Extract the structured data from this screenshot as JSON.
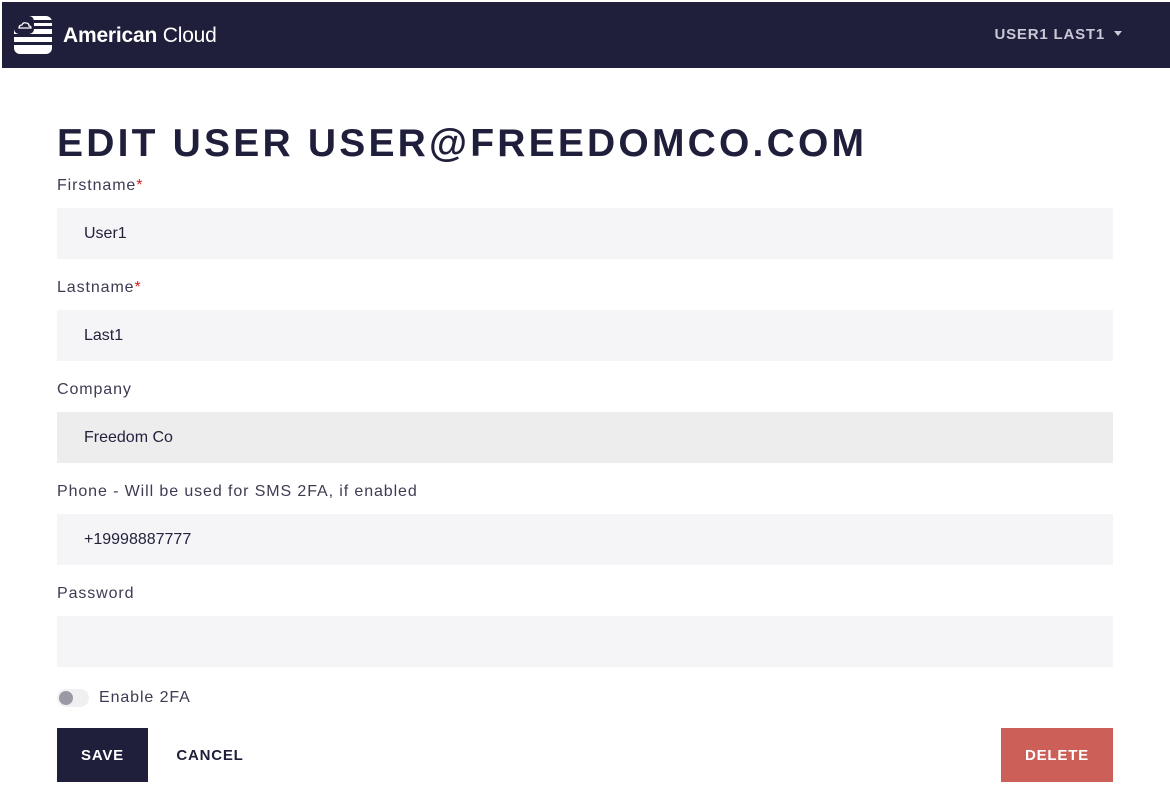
{
  "header": {
    "brand_bold": "American",
    "brand_regular": " Cloud",
    "user_menu_label": "USER1 LAST1"
  },
  "page": {
    "title": "EDIT USER USER@FREEDOMCO.COM"
  },
  "form": {
    "firstname": {
      "label": "Firstname",
      "required_mark": "*",
      "value": "User1"
    },
    "lastname": {
      "label": "Lastname",
      "required_mark": "*",
      "value": "Last1"
    },
    "company": {
      "label": "Company",
      "value": "Freedom Co"
    },
    "phone": {
      "label": "Phone - Will be used for SMS 2FA, if enabled",
      "value": "+19998887777"
    },
    "password": {
      "label": "Password",
      "value": ""
    },
    "enable_2fa": {
      "label": "Enable 2FA",
      "checked": false
    }
  },
  "actions": {
    "save_label": "SAVE",
    "cancel_label": "CANCEL",
    "delete_label": "DELETE"
  },
  "colors": {
    "navbar": "#1f1e3b",
    "primary_button": "#1f1e3b",
    "danger_button": "#cc5f58",
    "required": "#cc2222",
    "field_background": "#f5f5f7"
  },
  "icons": {
    "logo": "flag-cloud-logo-icon",
    "user_menu": "caret-down-icon"
  }
}
